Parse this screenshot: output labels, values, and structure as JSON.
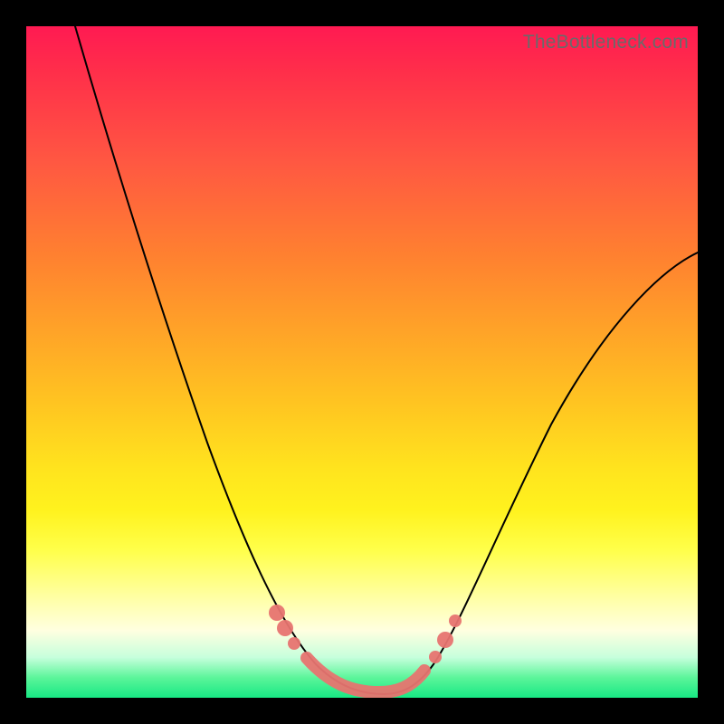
{
  "watermark": "TheBottleneck.com",
  "colors": {
    "frame": "#000000",
    "curve": "#000000",
    "marker": "#e77470",
    "gradient": [
      "#ff1a52",
      "#ff8030",
      "#ffe41e",
      "#ffffe0",
      "#17e884"
    ]
  },
  "chart_data": {
    "type": "line",
    "title": "",
    "xlabel": "",
    "ylabel": "",
    "xlim": [
      0,
      100
    ],
    "ylim": [
      0,
      100
    ],
    "x": [
      7,
      10,
      15,
      20,
      25,
      30,
      35,
      38,
      41,
      43,
      45,
      47,
      49,
      51,
      53,
      55,
      57,
      59,
      62,
      66,
      72,
      80,
      90,
      100
    ],
    "values": [
      100,
      93,
      82,
      71,
      60,
      48,
      35,
      26,
      18,
      12,
      8,
      5,
      3,
      2,
      2,
      3,
      5,
      8,
      13,
      20,
      30,
      42,
      55,
      66
    ],
    "annotations": [
      {
        "kind": "highlight-segment",
        "x_range": [
          41,
          58
        ],
        "y": 2
      },
      {
        "kind": "highlight-dot",
        "x": 38,
        "y": 18
      },
      {
        "kind": "highlight-dot",
        "x": 40,
        "y": 13
      },
      {
        "kind": "highlight-dot",
        "x": 59,
        "y": 8
      },
      {
        "kind": "highlight-dot",
        "x": 61,
        "y": 12
      }
    ]
  }
}
